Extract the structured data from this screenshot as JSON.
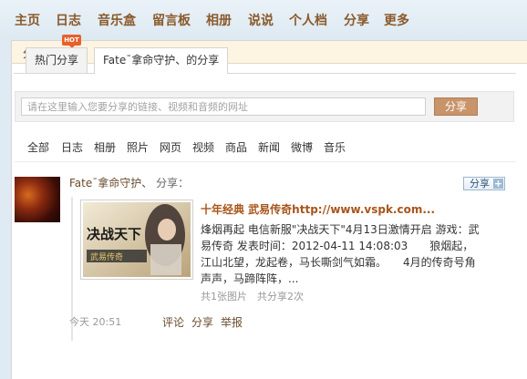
{
  "nav": {
    "items": [
      "主页",
      "日志",
      "音乐盒",
      "留言板",
      "相册",
      "说说",
      "个人档",
      "分享",
      "更多"
    ]
  },
  "panel": {
    "title": "分享"
  },
  "tabs": {
    "hot_badge": "HOT",
    "items": [
      {
        "label": "热门分享",
        "active": false
      },
      {
        "label": "Fate¯拿命守护、的分享",
        "active": true
      }
    ]
  },
  "share_bar": {
    "placeholder": "请在这里输入您要分享的链接、视频和音频的网址",
    "button": "分享"
  },
  "filters": [
    "全部",
    "日志",
    "相册",
    "照片",
    "网页",
    "视频",
    "商品",
    "新闻",
    "微博",
    "音乐"
  ],
  "entry": {
    "poster": "Fate¯拿命守护、",
    "action": "分享：",
    "share_button": "分享",
    "link_title": "十年经典 武易传奇http://www.vspk.com...",
    "description": "烽烟再起 电信新服\"决战天下\"4月13日激情开启 游戏：武易传奇 发表时间：2012-04-11 14:08:03　　狼烟起，江山北望，龙起卷，马长嘶剑气如霜。　　4月的传奇号角声声，马蹄阵阵，...",
    "meta": "共1张图片　共分享2次",
    "time": "今天 20:51",
    "actions": [
      "评论",
      "分享",
      "举报"
    ],
    "thumbnail": {
      "text_main": "决战天下",
      "text_sub": "武易传奇"
    }
  },
  "colors": {
    "nav_text": "#8a5a2b",
    "link": "#a8551a",
    "button": "#c8946a",
    "background": "#dfeaf3"
  }
}
